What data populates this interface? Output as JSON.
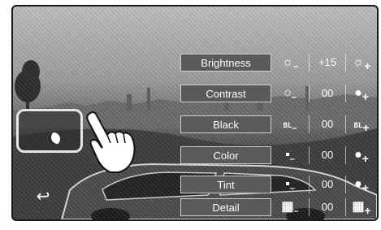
{
  "picture": {
    "settings": [
      {
        "label": "Brightness",
        "value": "+15",
        "minus_icon": "sun-dim-icon",
        "plus_icon": "sun-bright-icon",
        "minus_glyph": "☼",
        "plus_glyph": "☼"
      },
      {
        "label": "Contrast",
        "value": "00",
        "minus_icon": "circle-outline-icon",
        "plus_icon": "circle-filled-icon",
        "minus_glyph": "○",
        "plus_glyph": "●"
      },
      {
        "label": "Black",
        "value": "00",
        "minus_icon": "bl-minus-icon",
        "plus_icon": "bl-plus-icon",
        "minus_glyph": "BL",
        "plus_glyph": "BL"
      },
      {
        "label": "Color",
        "value": "00",
        "minus_icon": "color-minus-icon",
        "plus_icon": "color-plus-icon",
        "minus_glyph": "▪",
        "plus_glyph": "●"
      },
      {
        "label": "Tint",
        "value": "00",
        "minus_icon": "tint-minus-icon",
        "plus_icon": "tint-plus-icon",
        "minus_glyph": "▪",
        "plus_glyph": "●"
      },
      {
        "label": "Detail",
        "value": "00",
        "minus_icon": "checker-minus-icon",
        "plus_icon": "checker-plus-icon",
        "minus_glyph": "▦",
        "plus_glyph": "▦"
      }
    ],
    "minus_sign": "–",
    "plus_sign": "+"
  },
  "mode_toggle": {
    "icon": "moon-icon"
  },
  "back_button": {
    "glyph": "↩",
    "icon": "back-arrow-icon"
  },
  "colors": {
    "label_bg": "#5a5a5a",
    "text": "#ffffff",
    "frame": "#1a1a1a"
  }
}
